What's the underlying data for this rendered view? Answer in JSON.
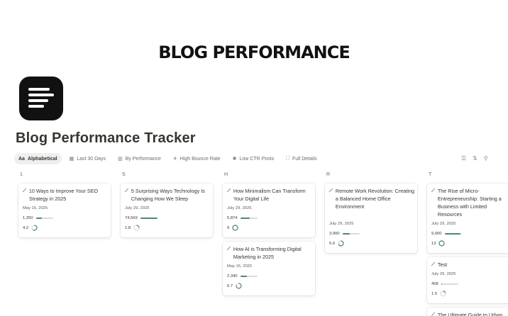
{
  "banner": "BLOG PERFORMANCE",
  "page_title": "Blog Performance Tracker",
  "tabs": [
    {
      "label": "Alphabetical",
      "icon": "Aa",
      "active": true
    },
    {
      "label": "Last 30 Days",
      "icon": "calendar-icon"
    },
    {
      "label": "By Performance",
      "icon": "chart-icon"
    },
    {
      "label": "High Bounce Rate",
      "icon": "airplane-icon"
    },
    {
      "label": "Low CTR Posts",
      "icon": "sparkle-icon"
    },
    {
      "label": "Full Details",
      "icon": "expand-icon"
    }
  ],
  "toolbar_icons": [
    "filter-icon",
    "sort-icon",
    "search-icon"
  ],
  "columns": [
    {
      "label": "1",
      "cards": [
        {
          "title": "10 Ways to Improve Your SEO Strategy in 2025",
          "date": "May 15, 2025",
          "views": "1,250",
          "views_level": 0.35,
          "rate": "4.2",
          "rate_level": 0.6
        }
      ]
    },
    {
      "label": "S",
      "cards": [
        {
          "title": "5 Surprising Ways Technology Is Changing How We Sleep",
          "date": "July 29, 2025",
          "views": "74,569",
          "views_level": 1.0,
          "rate": "1.8",
          "rate_level": 0.25
        }
      ]
    },
    {
      "label": "H",
      "cards": [
        {
          "title": "How Minimalism Can Transform Your Digital Life",
          "date": "July 29, 2025",
          "views": "5,874",
          "views_level": 0.55,
          "rate": "9",
          "rate_level": 1.0
        },
        {
          "title": "How AI is Transforming Digital Marketing in 2025",
          "date": "May 16, 2025",
          "views": "2,340",
          "views_level": 0.4,
          "rate": "6.7",
          "rate_level": 0.8
        }
      ]
    },
    {
      "label": "R",
      "cards": [
        {
          "title": "Remote Work Revolution: Creating a Balanced Home Office Environment",
          "date": "July 29, 2025",
          "views": "3,900",
          "views_level": 0.45,
          "rate": "5.6",
          "rate_level": 0.7
        }
      ]
    },
    {
      "label": "T",
      "cards": [
        {
          "title": "The Rise of Micro-Entrepreneurship: Starting a Business with Limited Resources",
          "date": "July 29, 2025",
          "views": "9,000",
          "views_level": 0.95,
          "rate": "13",
          "rate_level": 1.0
        },
        {
          "title": "Test",
          "date": "July 29, 2025",
          "views": "458",
          "views_level": 0.05,
          "rate": "1.5",
          "rate_level": 0.2
        },
        {
          "title": "The Ultimate Guide to Urban",
          "date": "",
          "views": "",
          "views_level": 0,
          "rate": "",
          "rate_level": 0
        }
      ]
    }
  ],
  "colors": {
    "bar": "#4f8a6a",
    "ring": "#4f8a6a",
    "track": "#dcdbd8"
  }
}
